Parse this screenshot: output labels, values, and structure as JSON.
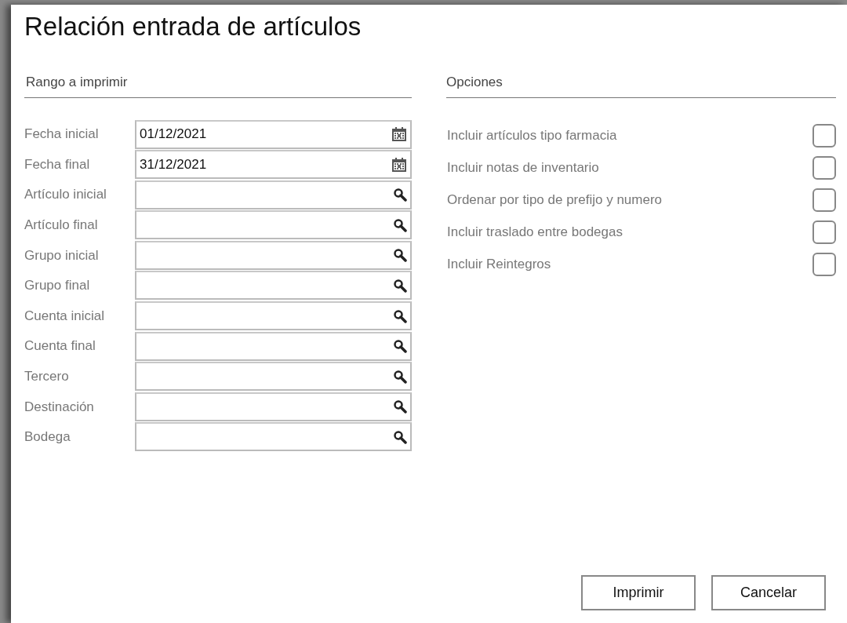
{
  "window": {
    "title": "Relación entrada de artículos"
  },
  "range": {
    "heading": "Rango a imprimir",
    "fields": [
      {
        "label": "Fecha inicial",
        "kind": "date",
        "value": "01/12/2021"
      },
      {
        "label": "Fecha final",
        "kind": "date",
        "value": "31/12/2021"
      },
      {
        "label": "Artículo inicial",
        "kind": "lookup"
      },
      {
        "label": "Artículo final",
        "kind": "lookup"
      },
      {
        "label": "Grupo inicial",
        "kind": "lookup"
      },
      {
        "label": "Grupo final",
        "kind": "lookup"
      },
      {
        "label": "Cuenta inicial",
        "kind": "lookup"
      },
      {
        "label": "Cuenta final",
        "kind": "lookup"
      },
      {
        "label": "Tercero",
        "kind": "lookup"
      },
      {
        "label": "Destinación",
        "kind": "lookup"
      },
      {
        "label": "Bodega",
        "kind": "lookup"
      }
    ]
  },
  "options": {
    "heading": "Opciones",
    "items": [
      {
        "label": "Incluir artículos tipo farmacia",
        "checked": false
      },
      {
        "label": "Incluir notas de inventario",
        "checked": false
      },
      {
        "label": "Ordenar por tipo de prefijo y numero",
        "checked": false
      },
      {
        "label": "Incluir traslado entre bodegas",
        "checked": false
      },
      {
        "label": "Incluir Reintegros",
        "checked": false
      }
    ]
  },
  "buttons": [
    "Imprimir",
    "Cancelar"
  ]
}
